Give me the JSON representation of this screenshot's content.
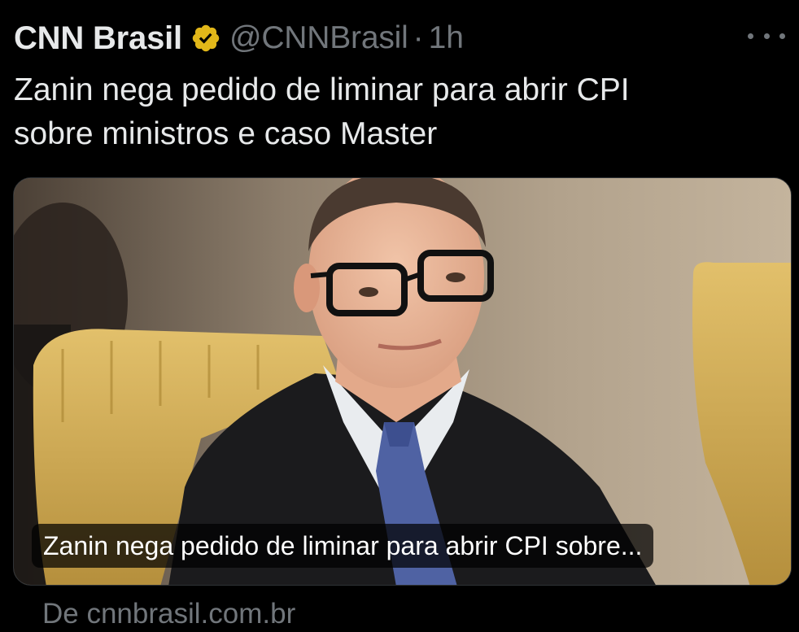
{
  "author": {
    "display_name": "CNN Brasil",
    "handle": "@CNNBrasil",
    "separator": "·",
    "time": "1h",
    "verified_badge_color": "#e2b719"
  },
  "tweet": {
    "text_line1": "Zanin nega pedido de liminar para abrir CPI",
    "text_line2": "sobre ministros e caso Master"
  },
  "card": {
    "caption": "Zanin nega pedido de liminar para abrir CPI sobre...",
    "source": "De cnnbrasil.com.br"
  },
  "icons": {
    "verified": "verified-badge-icon",
    "more": "more-options-icon"
  },
  "colors": {
    "background": "#000000",
    "text_primary": "#e7e9ea",
    "text_secondary": "#71767b"
  }
}
